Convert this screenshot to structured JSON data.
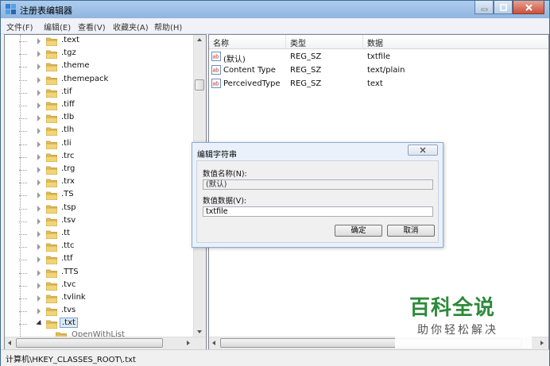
{
  "window": {
    "title": "注册表编辑器"
  },
  "menu": [
    "文件(F)",
    "编辑(E)",
    "查看(V)",
    "收藏夹(A)",
    "帮助(H)"
  ],
  "tree": {
    "items": [
      ".text",
      ".tgz",
      ".theme",
      ".themepack",
      ".tif",
      ".tiff",
      ".tlb",
      ".tlh",
      ".tli",
      ".trc",
      ".trg",
      ".trx",
      ".TS",
      ".tsp",
      ".tsv",
      ".tt",
      ".ttc",
      ".ttf",
      ".TTS",
      ".tvc",
      ".tvlink",
      ".tvs",
      ".txt"
    ],
    "partial_item": "OpenWithList",
    "selected": ".txt"
  },
  "list": {
    "columns": [
      "名称",
      "类型",
      "数据"
    ],
    "rows": [
      {
        "name": "(默认)",
        "type": "REG_SZ",
        "data": "txtfile"
      },
      {
        "name": "Content Type",
        "type": "REG_SZ",
        "data": "text/plain"
      },
      {
        "name": "PerceivedType",
        "type": "REG_SZ",
        "data": "text"
      }
    ]
  },
  "dialog": {
    "title": "编辑字符串",
    "name_label": "数值名称(N):",
    "name_value": "(默认)",
    "data_label": "数值数据(V):",
    "data_value": "txtfile",
    "ok_label": "确定",
    "cancel_label": "取消"
  },
  "status": {
    "path": "计算机\\HKEY_CLASSES_ROOT\\.txt"
  },
  "watermark": {
    "main": "百科全说",
    "sub": "助你轻松解决"
  },
  "colors": {
    "accent_green": "#2d8a3a",
    "selection": "#dce9f7",
    "folder": "#e8c15a"
  }
}
